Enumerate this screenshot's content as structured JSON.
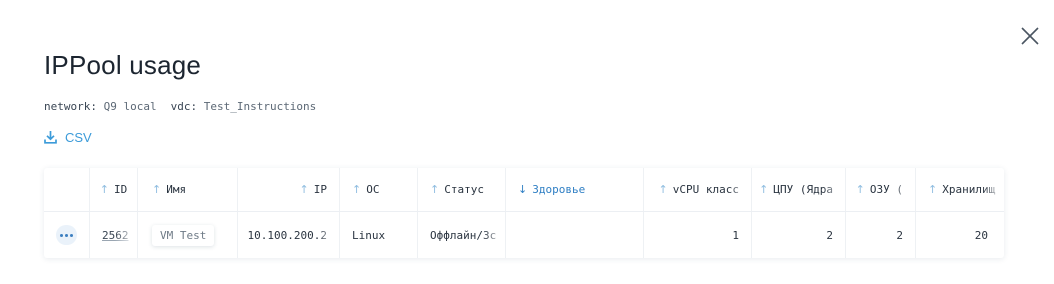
{
  "modal": {
    "title": "IPPool usage",
    "close_icon": "close-icon"
  },
  "meta": {
    "network_label": "network:",
    "network_value": "Q9 local",
    "vdc_label": "vdc:",
    "vdc_value": "Test_Instructions"
  },
  "export": {
    "csv_label": "CSV",
    "icon": "download-icon"
  },
  "table": {
    "columns": [
      {
        "label": "ID",
        "sort": "up"
      },
      {
        "label": "Имя",
        "sort": "up"
      },
      {
        "label": "IP",
        "sort": "up"
      },
      {
        "label": "ОС",
        "sort": "up"
      },
      {
        "label": "Статус",
        "sort": "up"
      },
      {
        "label": "Здоровье",
        "sort": "down",
        "active": true
      },
      {
        "label": "vCPU класс",
        "sort": "up"
      },
      {
        "label": "ЦПУ (Ядра",
        "sort": "up"
      },
      {
        "label": "ОЗУ (",
        "sort": "up"
      },
      {
        "label": "Хранилищ",
        "sort": "up"
      }
    ],
    "rows": [
      {
        "id": "2562",
        "name": "VM Test",
        "ip": "10.100.200.2",
        "os": "Linux",
        "status": "Оффлайн/Зс",
        "health": "",
        "vcpu_class": "1",
        "cpu_cores": "2",
        "ram": "2",
        "storage": "20"
      }
    ]
  },
  "colors": {
    "accent": "#3c9bd9",
    "active_sort": "#2f7fc4"
  }
}
